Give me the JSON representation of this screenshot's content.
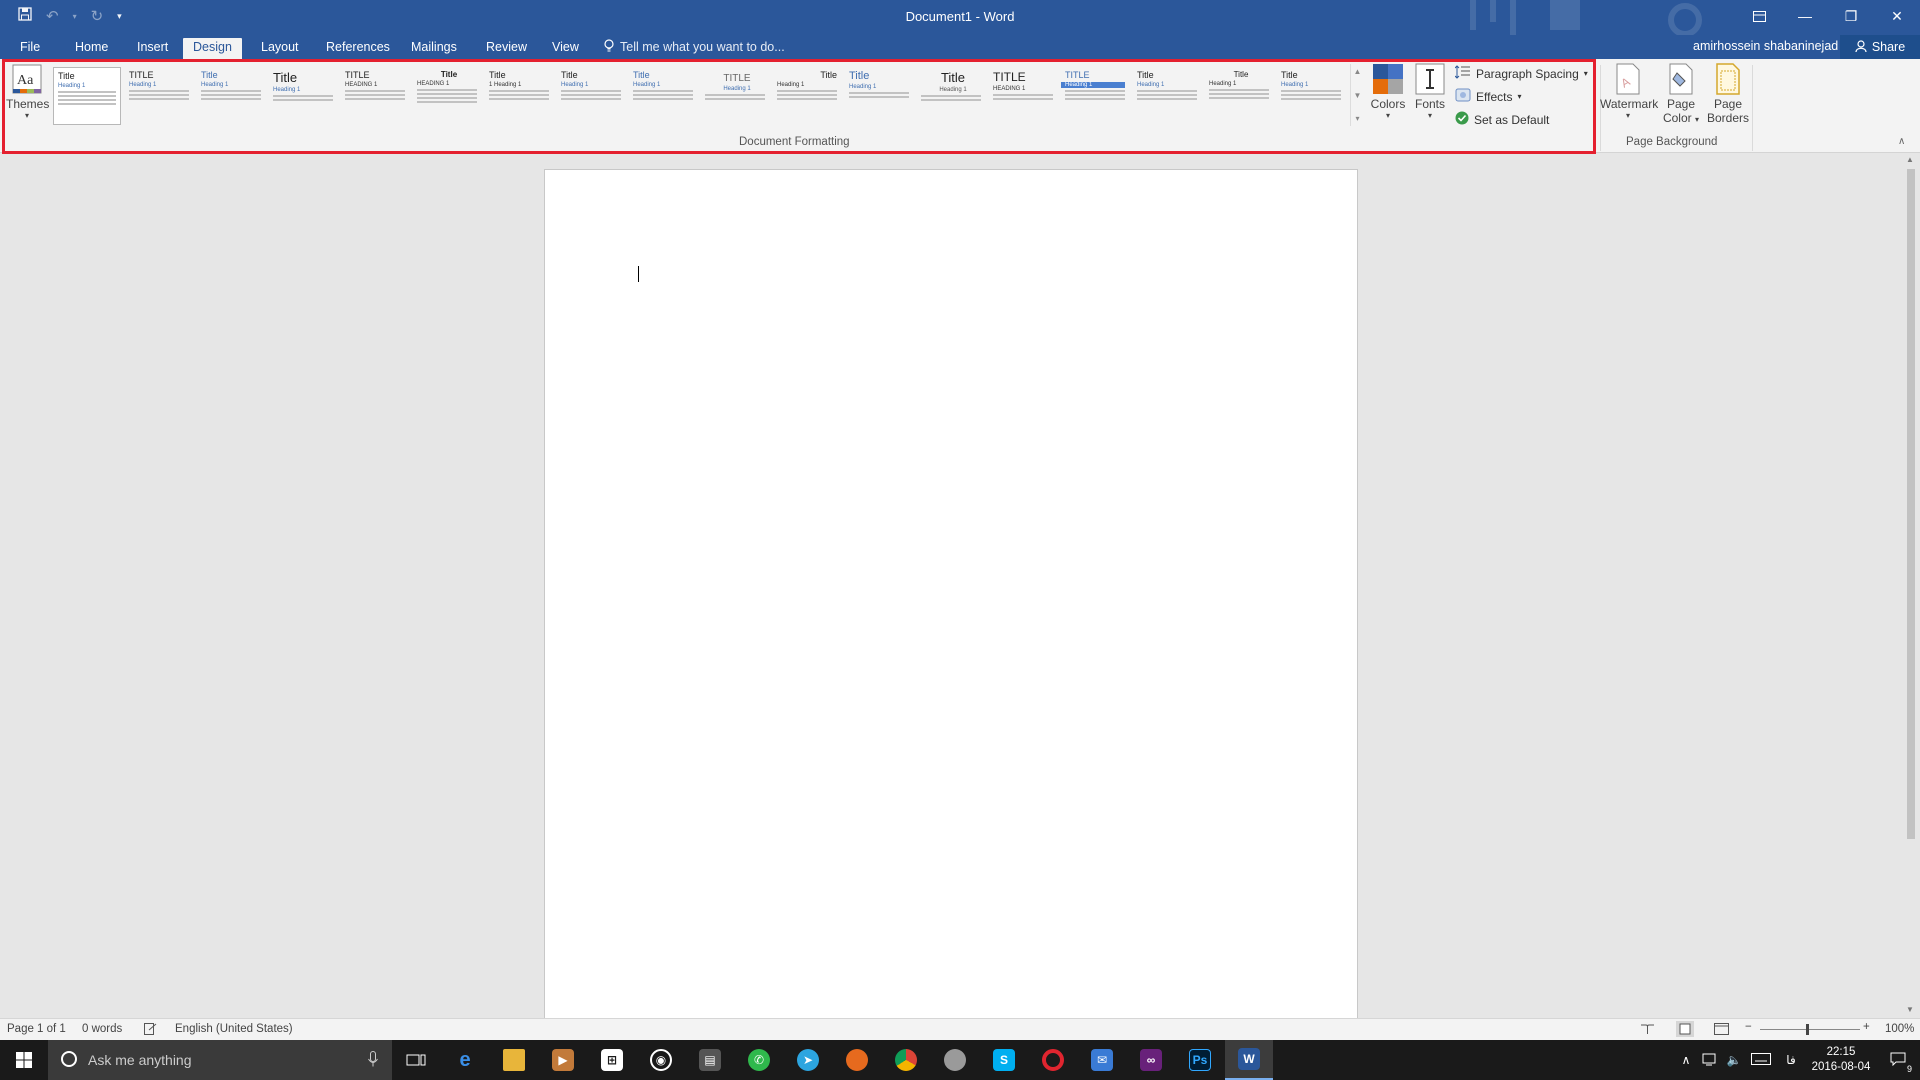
{
  "window": {
    "title": "Document1 - Word",
    "controls": [
      "ribbon-display-icon",
      "minimize-icon",
      "restore-icon",
      "close-icon"
    ]
  },
  "quick_access": [
    "save-icon",
    "undo-icon",
    "redo-icon",
    "customize-qat-icon"
  ],
  "tabs": [
    {
      "label": "File"
    },
    {
      "label": "Home"
    },
    {
      "label": "Insert"
    },
    {
      "label": "Design",
      "active": true
    },
    {
      "label": "Layout"
    },
    {
      "label": "References"
    },
    {
      "label": "Mailings"
    },
    {
      "label": "Review"
    },
    {
      "label": "View"
    }
  ],
  "tell_me": "Tell me what you want to do...",
  "user": "amirhossein shabaninejad",
  "share_label": "Share",
  "ribbon": {
    "themes_label": "Themes",
    "gallery": [
      {
        "title": "Title",
        "heading": "Heading 1"
      },
      {
        "title": "TITLE",
        "heading": "Heading 1"
      },
      {
        "title": "Title",
        "heading": "Heading 1"
      },
      {
        "title": "Title",
        "heading": "Heading 1"
      },
      {
        "title": "TITLE",
        "heading": "HEADING 1"
      },
      {
        "title": "Title",
        "heading": "HEADING 1"
      },
      {
        "title": "Title",
        "heading": "1  Heading 1"
      },
      {
        "title": "Title",
        "heading": "Heading 1"
      },
      {
        "title": "Title",
        "heading": "Heading 1"
      },
      {
        "title": "TITLE",
        "heading": "Heading 1"
      },
      {
        "title": "Title",
        "heading": "Heading 1"
      },
      {
        "title": "Title",
        "heading": "Heading 1"
      },
      {
        "title": "Title",
        "heading": "Heading 1"
      },
      {
        "title": "TITLE",
        "heading": "HEADING 1"
      },
      {
        "title": "TITLE",
        "heading": "Heading 1"
      },
      {
        "title": "Title",
        "heading": "Heading 1"
      },
      {
        "title": "Title",
        "heading": "Heading 1"
      },
      {
        "title": "Title",
        "heading": "Heading 1"
      }
    ],
    "colors_label": "Colors",
    "fonts_label": "Fonts",
    "paragraph_spacing_label": "Paragraph Spacing",
    "effects_label": "Effects",
    "set_default_label": "Set as Default",
    "document_formatting_label": "Document Formatting",
    "watermark_label": "Watermark",
    "page_color_label_1": "Page",
    "page_color_label_2": "Color",
    "page_borders_label_1": "Page",
    "page_borders_label_2": "Borders",
    "page_background_label": "Page Background",
    "accent_color": "#2b579a",
    "highlight_color": "#e4202f"
  },
  "status": {
    "page": "Page 1 of 1",
    "words": "0 words",
    "language": "English (United States)",
    "zoom": "100%"
  },
  "taskbar": {
    "search_placeholder": "Ask me anything",
    "apps": [
      "task-view-icon",
      "edge-icon",
      "file-explorer-icon",
      "media-player-icon",
      "store-icon",
      "groove-icon",
      "movies-icon",
      "whatsapp-icon",
      "telegram-icon",
      "firefox-icon",
      "chrome-icon",
      "game-icon",
      "skype-icon",
      "opera-icon",
      "mail-icon",
      "visual-studio-icon",
      "photoshop-icon",
      "word-icon"
    ],
    "lang_indicator": "فا",
    "time": "22:15",
    "date": "2016-08-04",
    "notifications": "9"
  }
}
